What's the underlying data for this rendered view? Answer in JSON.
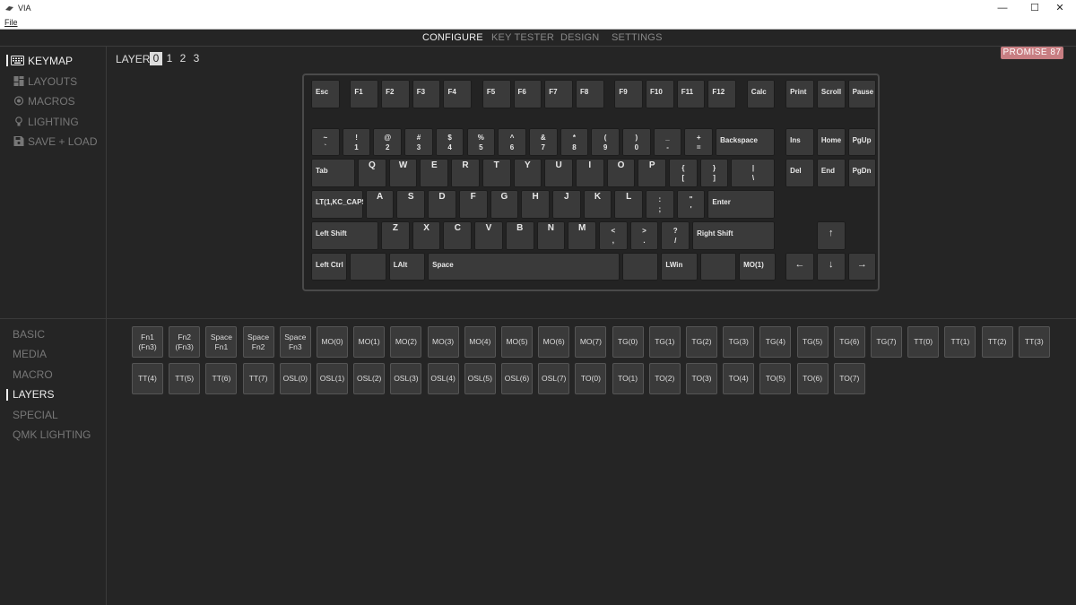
{
  "window": {
    "title": "VIA",
    "minimize": "—",
    "maximize": "☐",
    "close": "✕"
  },
  "menu": {
    "file": "File"
  },
  "nav": {
    "tabs": [
      "CONFIGURE",
      "KEY TESTER",
      "DESIGN",
      "SETTINGS"
    ],
    "active": "CONFIGURE"
  },
  "sidebar": {
    "items": [
      {
        "label": "KEYMAP",
        "icon": "keyboard-icon",
        "active": true
      },
      {
        "label": "LAYOUTS",
        "icon": "layout-grid-icon",
        "active": false
      },
      {
        "label": "MACROS",
        "icon": "macro-circle-icon",
        "active": false
      },
      {
        "label": "LIGHTING",
        "icon": "lightbulb-icon",
        "active": false
      },
      {
        "label": "SAVE + LOAD",
        "icon": "floppy-disk-icon",
        "active": false
      }
    ]
  },
  "layers": {
    "label": "LAYER",
    "numbers": [
      "0",
      "1",
      "2",
      "3"
    ],
    "active": "0"
  },
  "keyboard_name": "PROMISE 87",
  "keymap": {
    "keys": [
      {
        "id": "esc",
        "label": "Esc"
      },
      {
        "id": "f1",
        "label": "F1"
      },
      {
        "id": "f2",
        "label": "F2"
      },
      {
        "id": "f3",
        "label": "F3"
      },
      {
        "id": "f4",
        "label": "F4"
      },
      {
        "id": "f5",
        "label": "F5"
      },
      {
        "id": "f6",
        "label": "F6"
      },
      {
        "id": "f7",
        "label": "F7"
      },
      {
        "id": "f8",
        "label": "F8"
      },
      {
        "id": "f9",
        "label": "F9"
      },
      {
        "id": "f10",
        "label": "F10"
      },
      {
        "id": "f11",
        "label": "F11"
      },
      {
        "id": "f12",
        "label": "F12"
      },
      {
        "id": "calc",
        "label": "Calc"
      },
      {
        "id": "print",
        "label": "Print"
      },
      {
        "id": "scroll",
        "label": "Scroll"
      },
      {
        "id": "pause",
        "label": "Pause"
      },
      {
        "id": "grave",
        "top": "~",
        "bottom": "`"
      },
      {
        "id": "n1",
        "top": "!",
        "bottom": "1"
      },
      {
        "id": "n2",
        "top": "@",
        "bottom": "2"
      },
      {
        "id": "n3",
        "top": "#",
        "bottom": "3"
      },
      {
        "id": "n4",
        "top": "$",
        "bottom": "4"
      },
      {
        "id": "n5",
        "top": "%",
        "bottom": "5"
      },
      {
        "id": "n6",
        "top": "^",
        "bottom": "6"
      },
      {
        "id": "n7",
        "top": "&",
        "bottom": "7"
      },
      {
        "id": "n8",
        "top": "*",
        "bottom": "8"
      },
      {
        "id": "n9",
        "top": "(",
        "bottom": "9"
      },
      {
        "id": "n0",
        "top": ")",
        "bottom": "0"
      },
      {
        "id": "minus",
        "top": "_",
        "bottom": "-"
      },
      {
        "id": "equal",
        "top": "+",
        "bottom": "="
      },
      {
        "id": "backspace",
        "label": "Backspace"
      },
      {
        "id": "ins",
        "label": "Ins"
      },
      {
        "id": "home",
        "label": "Home"
      },
      {
        "id": "pgup",
        "label": "PgUp"
      },
      {
        "id": "tab",
        "label": "Tab"
      },
      {
        "id": "q",
        "label": "Q"
      },
      {
        "id": "w",
        "label": "W"
      },
      {
        "id": "e",
        "label": "E"
      },
      {
        "id": "r",
        "label": "R"
      },
      {
        "id": "t",
        "label": "T"
      },
      {
        "id": "y",
        "label": "Y"
      },
      {
        "id": "u",
        "label": "U"
      },
      {
        "id": "i",
        "label": "I"
      },
      {
        "id": "o",
        "label": "O"
      },
      {
        "id": "p",
        "label": "P"
      },
      {
        "id": "lbracket",
        "top": "{",
        "bottom": "["
      },
      {
        "id": "rbracket",
        "top": "}",
        "bottom": "]"
      },
      {
        "id": "backslash",
        "top": "|",
        "bottom": "\\"
      },
      {
        "id": "del",
        "label": "Del"
      },
      {
        "id": "end",
        "label": "End"
      },
      {
        "id": "pgdn",
        "label": "PgDn"
      },
      {
        "id": "caps",
        "label": "LT(1,KC_CAPS)"
      },
      {
        "id": "a",
        "label": "A"
      },
      {
        "id": "s",
        "label": "S"
      },
      {
        "id": "d",
        "label": "D"
      },
      {
        "id": "f",
        "label": "F"
      },
      {
        "id": "g",
        "label": "G"
      },
      {
        "id": "h",
        "label": "H"
      },
      {
        "id": "j",
        "label": "J"
      },
      {
        "id": "k",
        "label": "K"
      },
      {
        "id": "l",
        "label": "L"
      },
      {
        "id": "semicolon",
        "top": ":",
        "bottom": ";"
      },
      {
        "id": "quote",
        "top": "\"",
        "bottom": "'"
      },
      {
        "id": "enter",
        "label": "Enter"
      },
      {
        "id": "lshift",
        "label": "Left Shift"
      },
      {
        "id": "z",
        "label": "Z"
      },
      {
        "id": "x",
        "label": "X"
      },
      {
        "id": "c",
        "label": "C"
      },
      {
        "id": "v",
        "label": "V"
      },
      {
        "id": "b",
        "label": "B"
      },
      {
        "id": "n",
        "label": "N"
      },
      {
        "id": "m",
        "label": "M"
      },
      {
        "id": "comma",
        "top": "<",
        "bottom": ","
      },
      {
        "id": "period",
        "top": ">",
        "bottom": "."
      },
      {
        "id": "slash",
        "top": "?",
        "bottom": "/"
      },
      {
        "id": "rshift",
        "label": "Right Shift"
      },
      {
        "id": "up",
        "label": "↑"
      },
      {
        "id": "lctrl",
        "label": "Left Ctrl"
      },
      {
        "id": "blank1",
        "label": ""
      },
      {
        "id": "lalt",
        "label": "LAlt"
      },
      {
        "id": "space",
        "label": "Space"
      },
      {
        "id": "blank2",
        "label": ""
      },
      {
        "id": "lwin",
        "label": "LWin"
      },
      {
        "id": "blank3",
        "label": ""
      },
      {
        "id": "mo1",
        "label": "MO(1)"
      },
      {
        "id": "left",
        "label": "←"
      },
      {
        "id": "down",
        "label": "↓"
      },
      {
        "id": "right",
        "label": "→"
      }
    ]
  },
  "categories": {
    "items": [
      "BASIC",
      "MEDIA",
      "MACRO",
      "LAYERS",
      "SPECIAL",
      "QMK LIGHTING"
    ],
    "active": "LAYERS"
  },
  "palette": {
    "keys": [
      [
        "Fn1",
        "(Fn3)"
      ],
      [
        "Fn2",
        "(Fn3)"
      ],
      [
        "Space",
        "Fn1"
      ],
      [
        "Space",
        "Fn2"
      ],
      [
        "Space",
        "Fn3"
      ],
      [
        "MO(0)"
      ],
      [
        "MO(1)"
      ],
      [
        "MO(2)"
      ],
      [
        "MO(3)"
      ],
      [
        "MO(4)"
      ],
      [
        "MO(5)"
      ],
      [
        "MO(6)"
      ],
      [
        "MO(7)"
      ],
      [
        "TG(0)"
      ],
      [
        "TG(1)"
      ],
      [
        "TG(2)"
      ],
      [
        "TG(3)"
      ],
      [
        "TG(4)"
      ],
      [
        "TG(5)"
      ],
      [
        "TG(6)"
      ],
      [
        "TG(7)"
      ],
      [
        "TT(0)"
      ],
      [
        "TT(1)"
      ],
      [
        "TT(2)"
      ],
      [
        "TT(3)"
      ],
      [
        "TT(4)"
      ],
      [
        "TT(5)"
      ],
      [
        "TT(6)"
      ],
      [
        "TT(7)"
      ],
      [
        "OSL(0)"
      ],
      [
        "OSL(1)"
      ],
      [
        "OSL(2)"
      ],
      [
        "OSL(3)"
      ],
      [
        "OSL(4)"
      ],
      [
        "OSL(5)"
      ],
      [
        "OSL(6)"
      ],
      [
        "OSL(7)"
      ],
      [
        "TO(0)"
      ],
      [
        "TO(1)"
      ],
      [
        "TO(2)"
      ],
      [
        "TO(3)"
      ],
      [
        "TO(4)"
      ],
      [
        "TO(5)"
      ],
      [
        "TO(6)"
      ],
      [
        "TO(7)"
      ]
    ]
  },
  "colors": {
    "accent_badge": "#c87e82",
    "background": "#252525",
    "key": "#3a3a3a"
  }
}
